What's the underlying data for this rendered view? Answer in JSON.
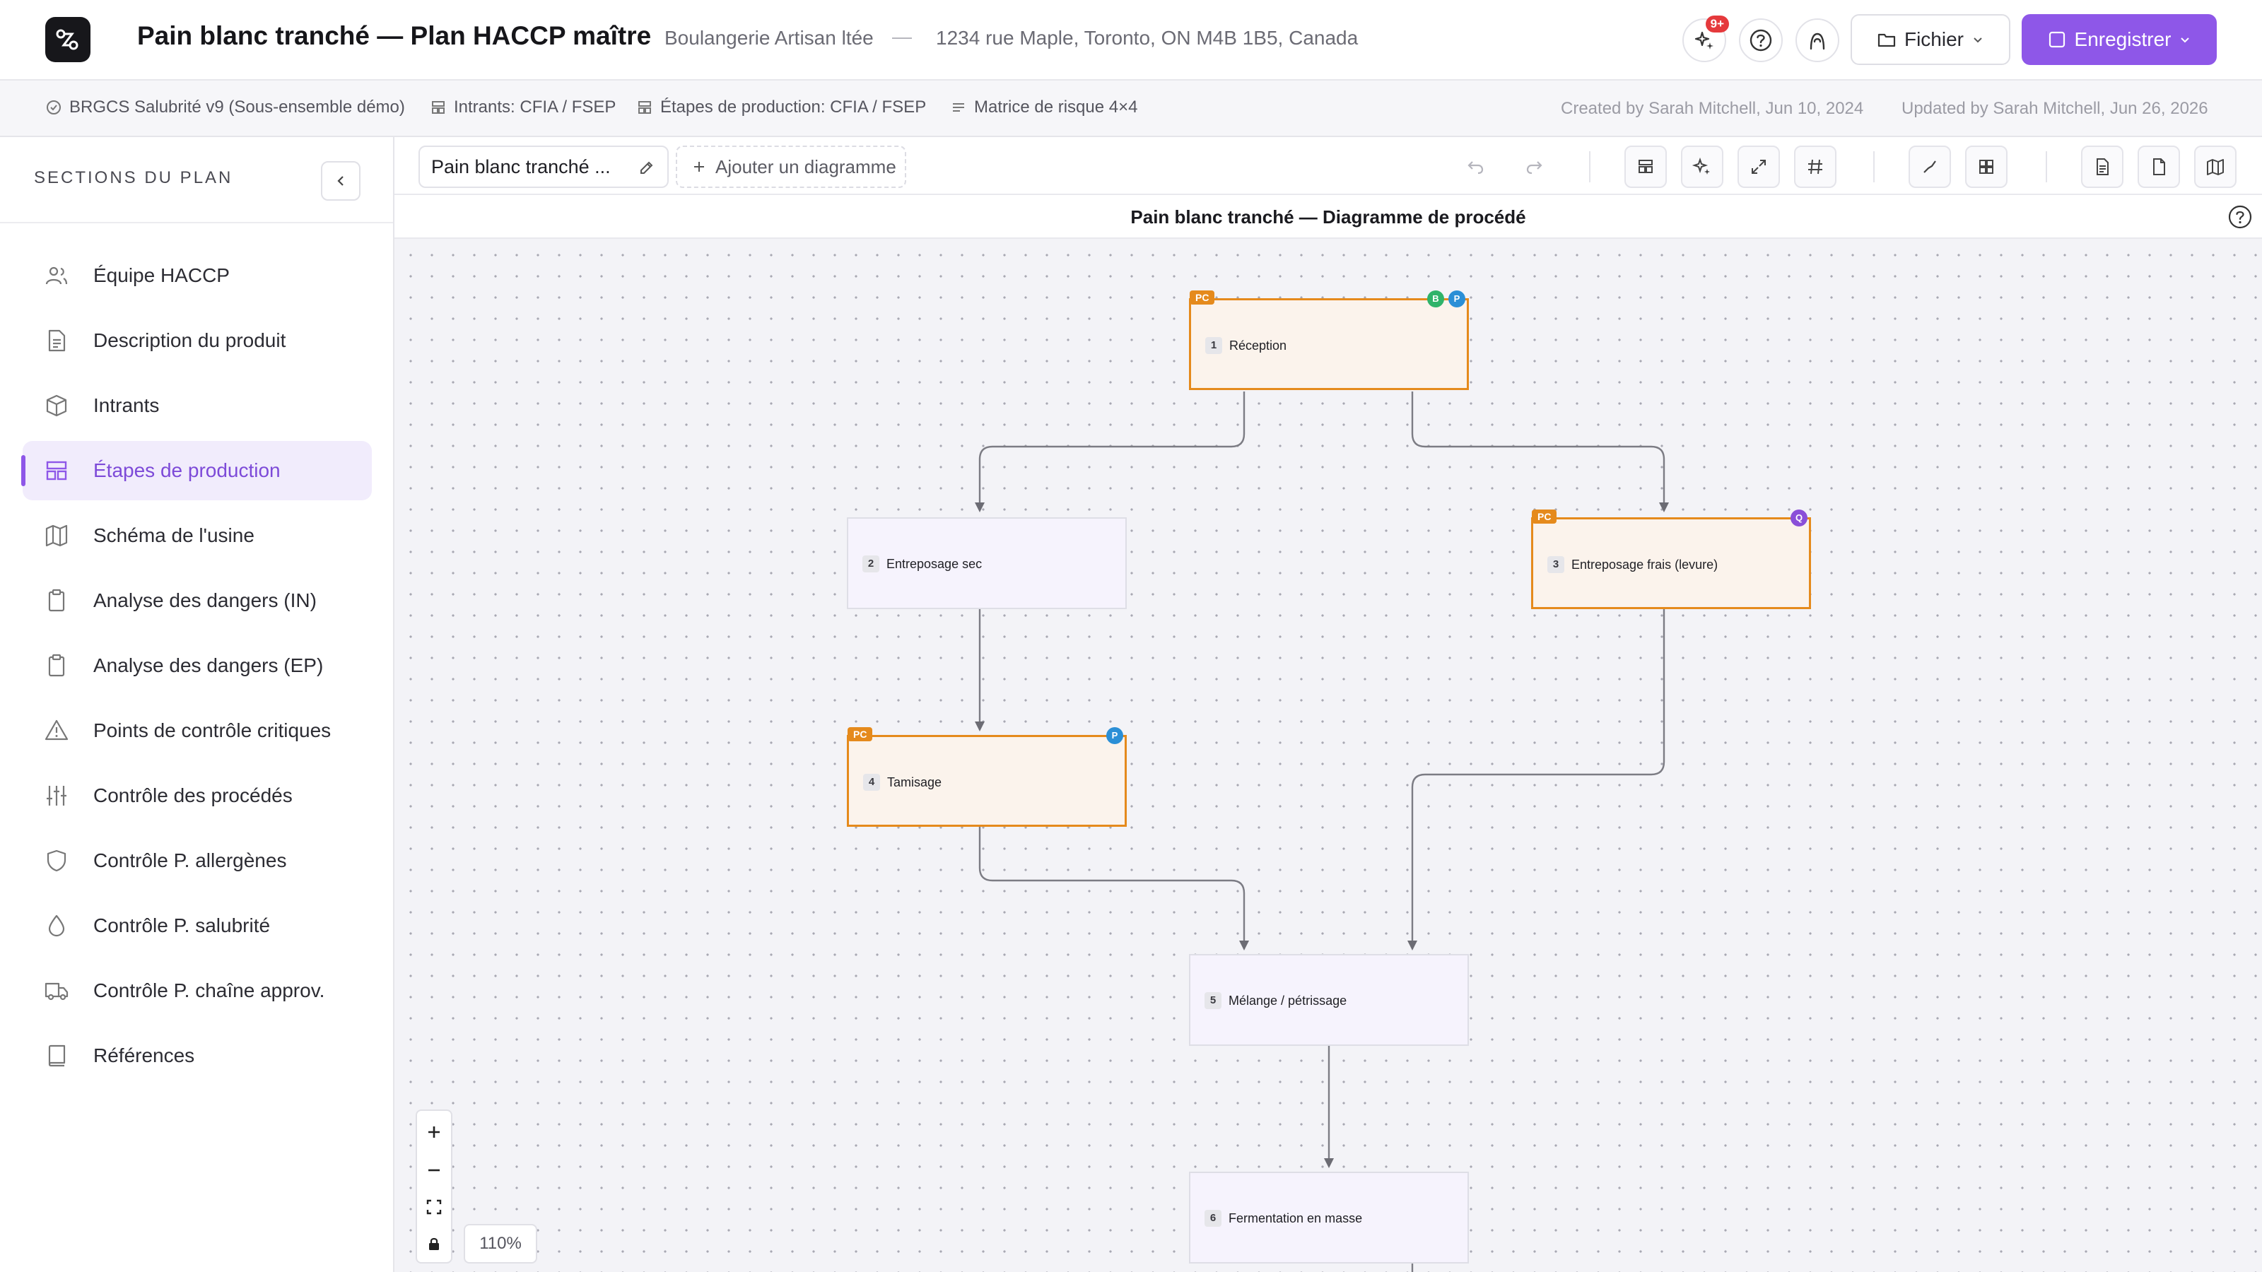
{
  "header": {
    "title": "Pain blanc tranché — Plan HACCP maître",
    "company": "Boulangerie Artisan ltée",
    "separator": "—",
    "address": "1234 rue Maple, Toronto, ON M4B 1B5, Canada",
    "notification_badge": "9+",
    "file_label": "Fichier",
    "save_label": "Enregistrer",
    "accent_color": "#8e57e8"
  },
  "subheader": {
    "standard": "BRGCS Salubrité v9 (Sous-ensemble démo)",
    "inputs": "Intrants: CFIA / FSEP",
    "steps": "Étapes de production: CFIA / FSEP",
    "matrix": "Matrice de risque 4×4",
    "created": "Created by Sarah Mitchell, Jun 10, 2024",
    "updated": "Updated by Sarah Mitchell, Jun 26, 2026"
  },
  "sidebar": {
    "title": "SECTIONS DU PLAN",
    "items": [
      {
        "label": "Équipe HACCP",
        "icon": "users-icon"
      },
      {
        "label": "Description du produit",
        "icon": "document-icon"
      },
      {
        "label": "Intrants",
        "icon": "box-icon"
      },
      {
        "label": "Étapes de production",
        "icon": "layout-icon",
        "active": true
      },
      {
        "label": "Schéma de l'usine",
        "icon": "map-icon"
      },
      {
        "label": "Analyse des dangers (IN)",
        "icon": "clipboard-icon"
      },
      {
        "label": "Analyse des dangers (EP)",
        "icon": "clipboard-icon"
      },
      {
        "label": "Points de contrôle critiques",
        "icon": "warning-icon"
      },
      {
        "label": "Contrôle des procédés",
        "icon": "sliders-icon"
      },
      {
        "label": "Contrôle P. allergènes",
        "icon": "shield-icon"
      },
      {
        "label": "Contrôle P. salubrité",
        "icon": "droplet-icon"
      },
      {
        "label": "Contrôle P. chaîne approv.",
        "icon": "truck-icon"
      },
      {
        "label": "Références",
        "icon": "book-icon"
      }
    ]
  },
  "toolbar": {
    "diagram_tab": "Pain blanc tranché ...",
    "add_diagram": "Ajouter un diagramme"
  },
  "diagram": {
    "title": "Pain blanc tranché — Diagramme de procédé",
    "zoom": "110%",
    "nodes": [
      {
        "num": "1",
        "label": "Réception",
        "pc": true,
        "tags": [
          "B",
          "P"
        ]
      },
      {
        "num": "2",
        "label": "Entreposage sec",
        "pc": false,
        "tags": []
      },
      {
        "num": "3",
        "label": "Entreposage frais (levure)",
        "pc": true,
        "tags": [
          "Q"
        ]
      },
      {
        "num": "4",
        "label": "Tamisage",
        "pc": true,
        "tags": [
          "P"
        ]
      },
      {
        "num": "5",
        "label": "Mélange / pétrissage",
        "pc": false,
        "tags": []
      },
      {
        "num": "6",
        "label": "Fermentation en masse",
        "pc": false,
        "tags": []
      }
    ],
    "pc_tag": "PC",
    "colors": {
      "pc_border": "#e58a1c",
      "tag_b": "#2fb36a",
      "tag_p": "#2b8fd6",
      "tag_q": "#8a4fd8"
    }
  }
}
